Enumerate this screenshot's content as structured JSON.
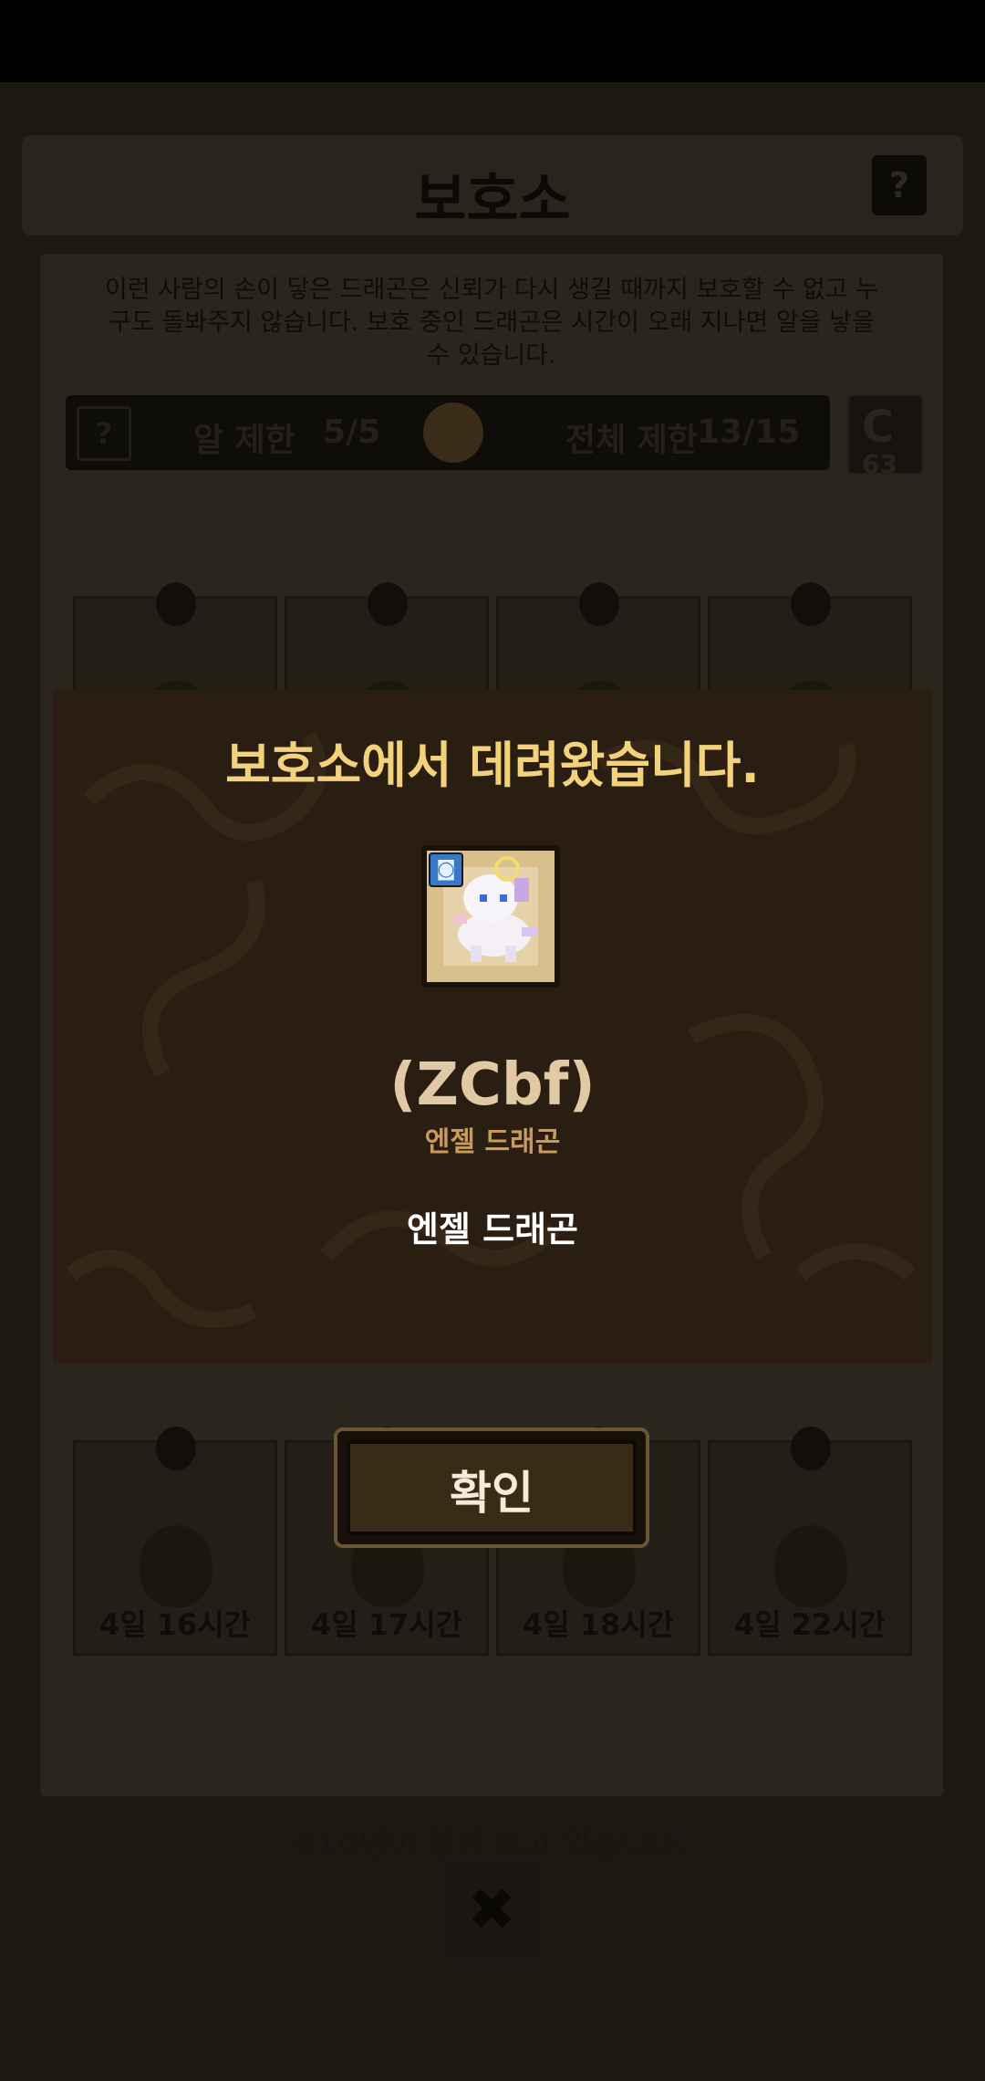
{
  "screen": {
    "title": "보호소",
    "help_label": "?",
    "description": "이런 사람의 손이 닿은 드래곤은 신뢰가 다시 생길 때까지 보호할 수 없고 누구도 돌봐주지 않습니다. 보호 중인 드래곤은 시간이 오래 지나면 알을 낳을 수 있습니다.",
    "limits": {
      "help_label": "?",
      "egg_label": "알 제한",
      "egg_value": "5/5",
      "total_label": "전체 제한",
      "total_value": "13/15"
    },
    "refresh_count": "63",
    "slots": [
      {
        "timer": ""
      },
      {
        "timer": ""
      },
      {
        "timer": ""
      },
      {
        "timer": ""
      },
      {
        "timer": "4일 16시간"
      },
      {
        "timer": "4일 17시간"
      },
      {
        "timer": "4일 18시간"
      },
      {
        "timer": "4일 22시간"
      }
    ],
    "watchers_text": "610명이 함께 보고 있습니다.",
    "close_label": "✖"
  },
  "modal": {
    "title": "보호소에서 데려왔습니다.",
    "badge_icon": "camera-icon",
    "dragon_name": "(ZCbf)",
    "dragon_species": "엔젤 드래곤",
    "dragon_desc": "엔젤 드래곤",
    "confirm_label": "확인"
  },
  "colors": {
    "modal_title": "#f2d27a",
    "name": "#e2c9a6",
    "species": "#c89a5c"
  }
}
